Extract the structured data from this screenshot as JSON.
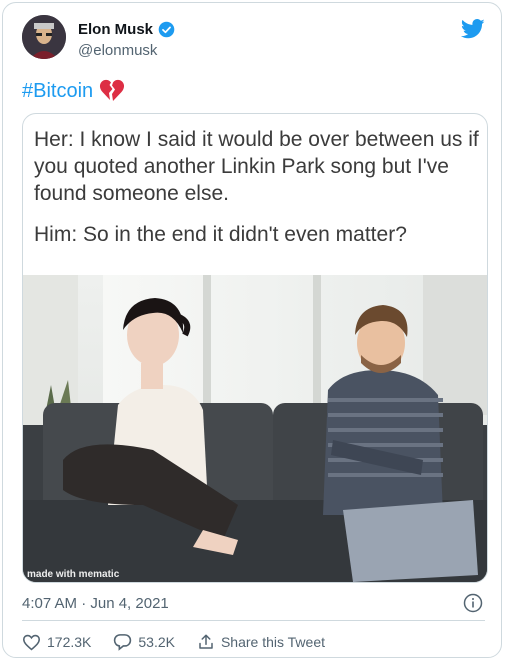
{
  "author": {
    "name": "Elon Musk",
    "handle": "@elonmusk",
    "verified_icon": "verified-badge-icon"
  },
  "brand": {
    "logo": "twitter-bird-icon",
    "accent_color": "#1d9bf0"
  },
  "tweet": {
    "hashtag": "#Bitcoin",
    "emoji": "broken-heart-icon"
  },
  "media": {
    "meme_line_1": "Her: I know I said it would be over between us if you quoted another Linkin Park song but I've found someone else.",
    "meme_line_2": "Him: So in the end it didn't even matter?",
    "watermark": "made with mematic"
  },
  "meta": {
    "timestamp": "4:07 AM · Jun 4, 2021",
    "info_icon": "info-icon"
  },
  "actions": {
    "likes": "172.3K",
    "replies": "53.2K",
    "share_label": "Share this Tweet"
  }
}
